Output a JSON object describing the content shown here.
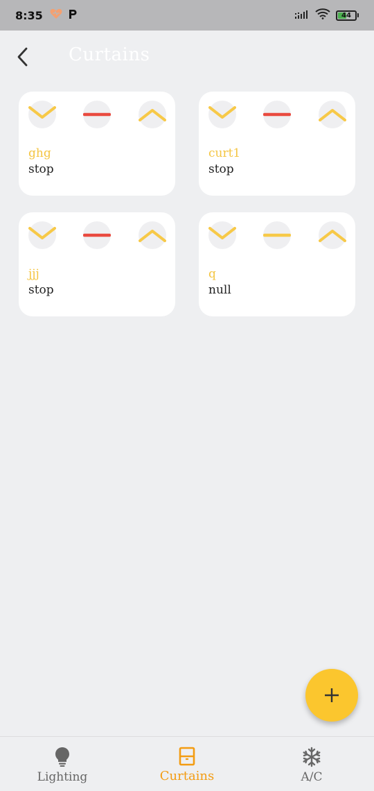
{
  "status_bar": {
    "time": "8:35",
    "battery_level": "44"
  },
  "header": {
    "title": "Curtains"
  },
  "curtains": [
    {
      "name": "ghg",
      "status": "stop",
      "stop_color": "#e94a3f"
    },
    {
      "name": "curt1",
      "status": "stop",
      "stop_color": "#e94a3f"
    },
    {
      "name": "jjj",
      "status": "stop",
      "stop_color": "#e94a3f"
    },
    {
      "name": "q",
      "status": "null",
      "stop_color": "#f7c948"
    }
  ],
  "bottom_nav": {
    "items": [
      {
        "label": "Lighting",
        "icon": "bulb-icon",
        "active": false
      },
      {
        "label": "Curtains",
        "icon": "curtain-icon",
        "active": true
      },
      {
        "label": "A/C",
        "icon": "snowflake-icon",
        "active": false
      }
    ]
  },
  "colors": {
    "accent": "#f4c542",
    "active_nav": "#f39c12",
    "stop_active": "#e94a3f",
    "fab": "#fbc62e",
    "background": "#eeeff1"
  }
}
